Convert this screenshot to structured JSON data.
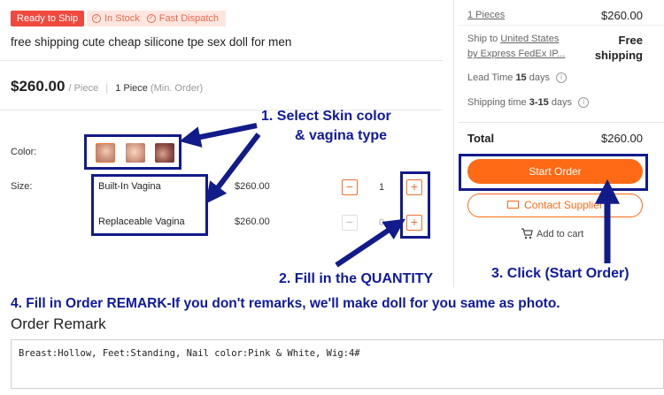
{
  "badges": {
    "ready": "Ready to Ship",
    "in_stock": "In Stock",
    "fast_dispatch": "Fast Dispatch"
  },
  "product": {
    "title": "free shipping cute cheap silicone tpe sex doll for men",
    "price": "$260.00",
    "unit": "/ Piece",
    "moq_qty": "1 Piece",
    "moq_label": "(Min. Order)"
  },
  "options": {
    "color_label": "Color:",
    "size_label": "Size:",
    "variants": [
      {
        "name": "Built-In Vagina",
        "price": "$260.00",
        "qty": "1"
      },
      {
        "name": "Replaceable Vagina",
        "price": "$260.00",
        "qty": "0"
      }
    ]
  },
  "summary": {
    "pieces": "1 Pieces",
    "pieces_price": "$260.00",
    "ship_to_prefix": "Ship to",
    "ship_to_country": "United States",
    "ship_via": "by Express FedEx IP...",
    "shipping_line1": "Free",
    "shipping_line2": "shipping",
    "lead_time_label": "Lead Time",
    "lead_time_value": "15",
    "lead_time_unit": "days",
    "shipping_time_label": "Shipping time",
    "shipping_time_value": "3-15",
    "shipping_time_unit": "days",
    "total_label": "Total",
    "total_value": "$260.00",
    "start_order": "Start Order",
    "contact_supplier": "Contact Supplier",
    "add_to_cart": "Add to cart"
  },
  "annotations": {
    "step1_line1": "1. Select Skin color",
    "step1_line2": "& vagina type",
    "step2": "2. Fill in the QUANTITY",
    "step3": "3. Click (Start Order)",
    "step4": "4. Fill in Order REMARK-If you don't remarks, we'll make doll for you same as photo."
  },
  "remark": {
    "title": "Order Remark",
    "value": "Breast:Hollow, Feet:Standing, Nail color:Pink & White, Wig:4#"
  },
  "colors": {
    "accent": "#ff6a14",
    "annotation": "#0f1a9c",
    "badge_red": "#f04a3e"
  }
}
